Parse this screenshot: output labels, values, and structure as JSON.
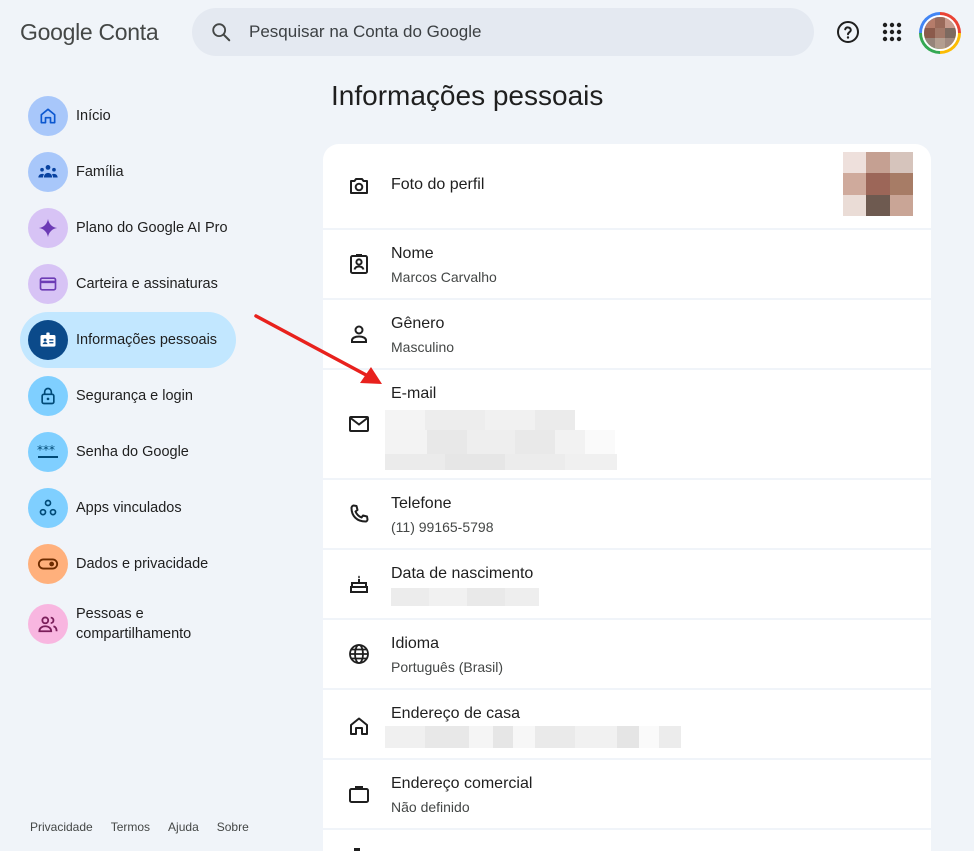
{
  "header": {
    "logo_brand": "Google",
    "logo_product": "Conta",
    "search_placeholder": "Pesquisar na Conta do Google"
  },
  "sidebar": {
    "items": [
      {
        "label": "Início",
        "icon": "home-icon",
        "color": "#a8c7fa"
      },
      {
        "label": "Família",
        "icon": "family-icon",
        "color": "#a8c7fa"
      },
      {
        "label": "Plano do Google AI Pro",
        "icon": "sparkle-icon",
        "color": "#d7c3f5"
      },
      {
        "label": "Carteira e assinaturas",
        "icon": "wallet-icon",
        "color": "#d7c3f5"
      },
      {
        "label": "Informações pessoais",
        "icon": "id-card-icon",
        "color": "#0b57d0"
      },
      {
        "label": "Segurança e login",
        "icon": "lock-icon",
        "color": "#7fcfff"
      },
      {
        "label": "Senha do Google",
        "icon": "password-icon",
        "color": "#7fcfff"
      },
      {
        "label": "Apps vinculados",
        "icon": "linked-apps-icon",
        "color": "#7fcfff"
      },
      {
        "label": "Dados e privacidade",
        "icon": "toggle-icon",
        "color": "#ffb07c"
      },
      {
        "label": "Pessoas e compartilhamento",
        "icon": "people-icon",
        "color": "#f8b6e0"
      }
    ],
    "footer": [
      "Privacidade",
      "Termos",
      "Ajuda",
      "Sobre"
    ]
  },
  "main": {
    "title": "Informações pessoais",
    "rows": [
      {
        "title": "Foto do perfil",
        "value": "",
        "icon": "camera-icon"
      },
      {
        "title": "Nome",
        "value": "Marcos Carvalho",
        "icon": "badge-icon"
      },
      {
        "title": "Gênero",
        "value": "Masculino",
        "icon": "person-icon"
      },
      {
        "title": "E-mail",
        "value": "",
        "icon": "mail-icon"
      },
      {
        "title": "Telefone",
        "value": "(11) 99165-5798",
        "icon": "phone-icon"
      },
      {
        "title": "Data de nascimento",
        "value": "",
        "icon": "cake-icon"
      },
      {
        "title": "Idioma",
        "value": "Português (Brasil)",
        "icon": "globe-icon"
      },
      {
        "title": "Endereço de casa",
        "value": "",
        "icon": "house-icon"
      },
      {
        "title": "Endereço comercial",
        "value": "Não definido",
        "icon": "briefcase-icon"
      }
    ]
  },
  "colors": {
    "background": "#f0f4f9",
    "active_nav": "#c2e7ff",
    "annotation_arrow": "#e8211d"
  }
}
